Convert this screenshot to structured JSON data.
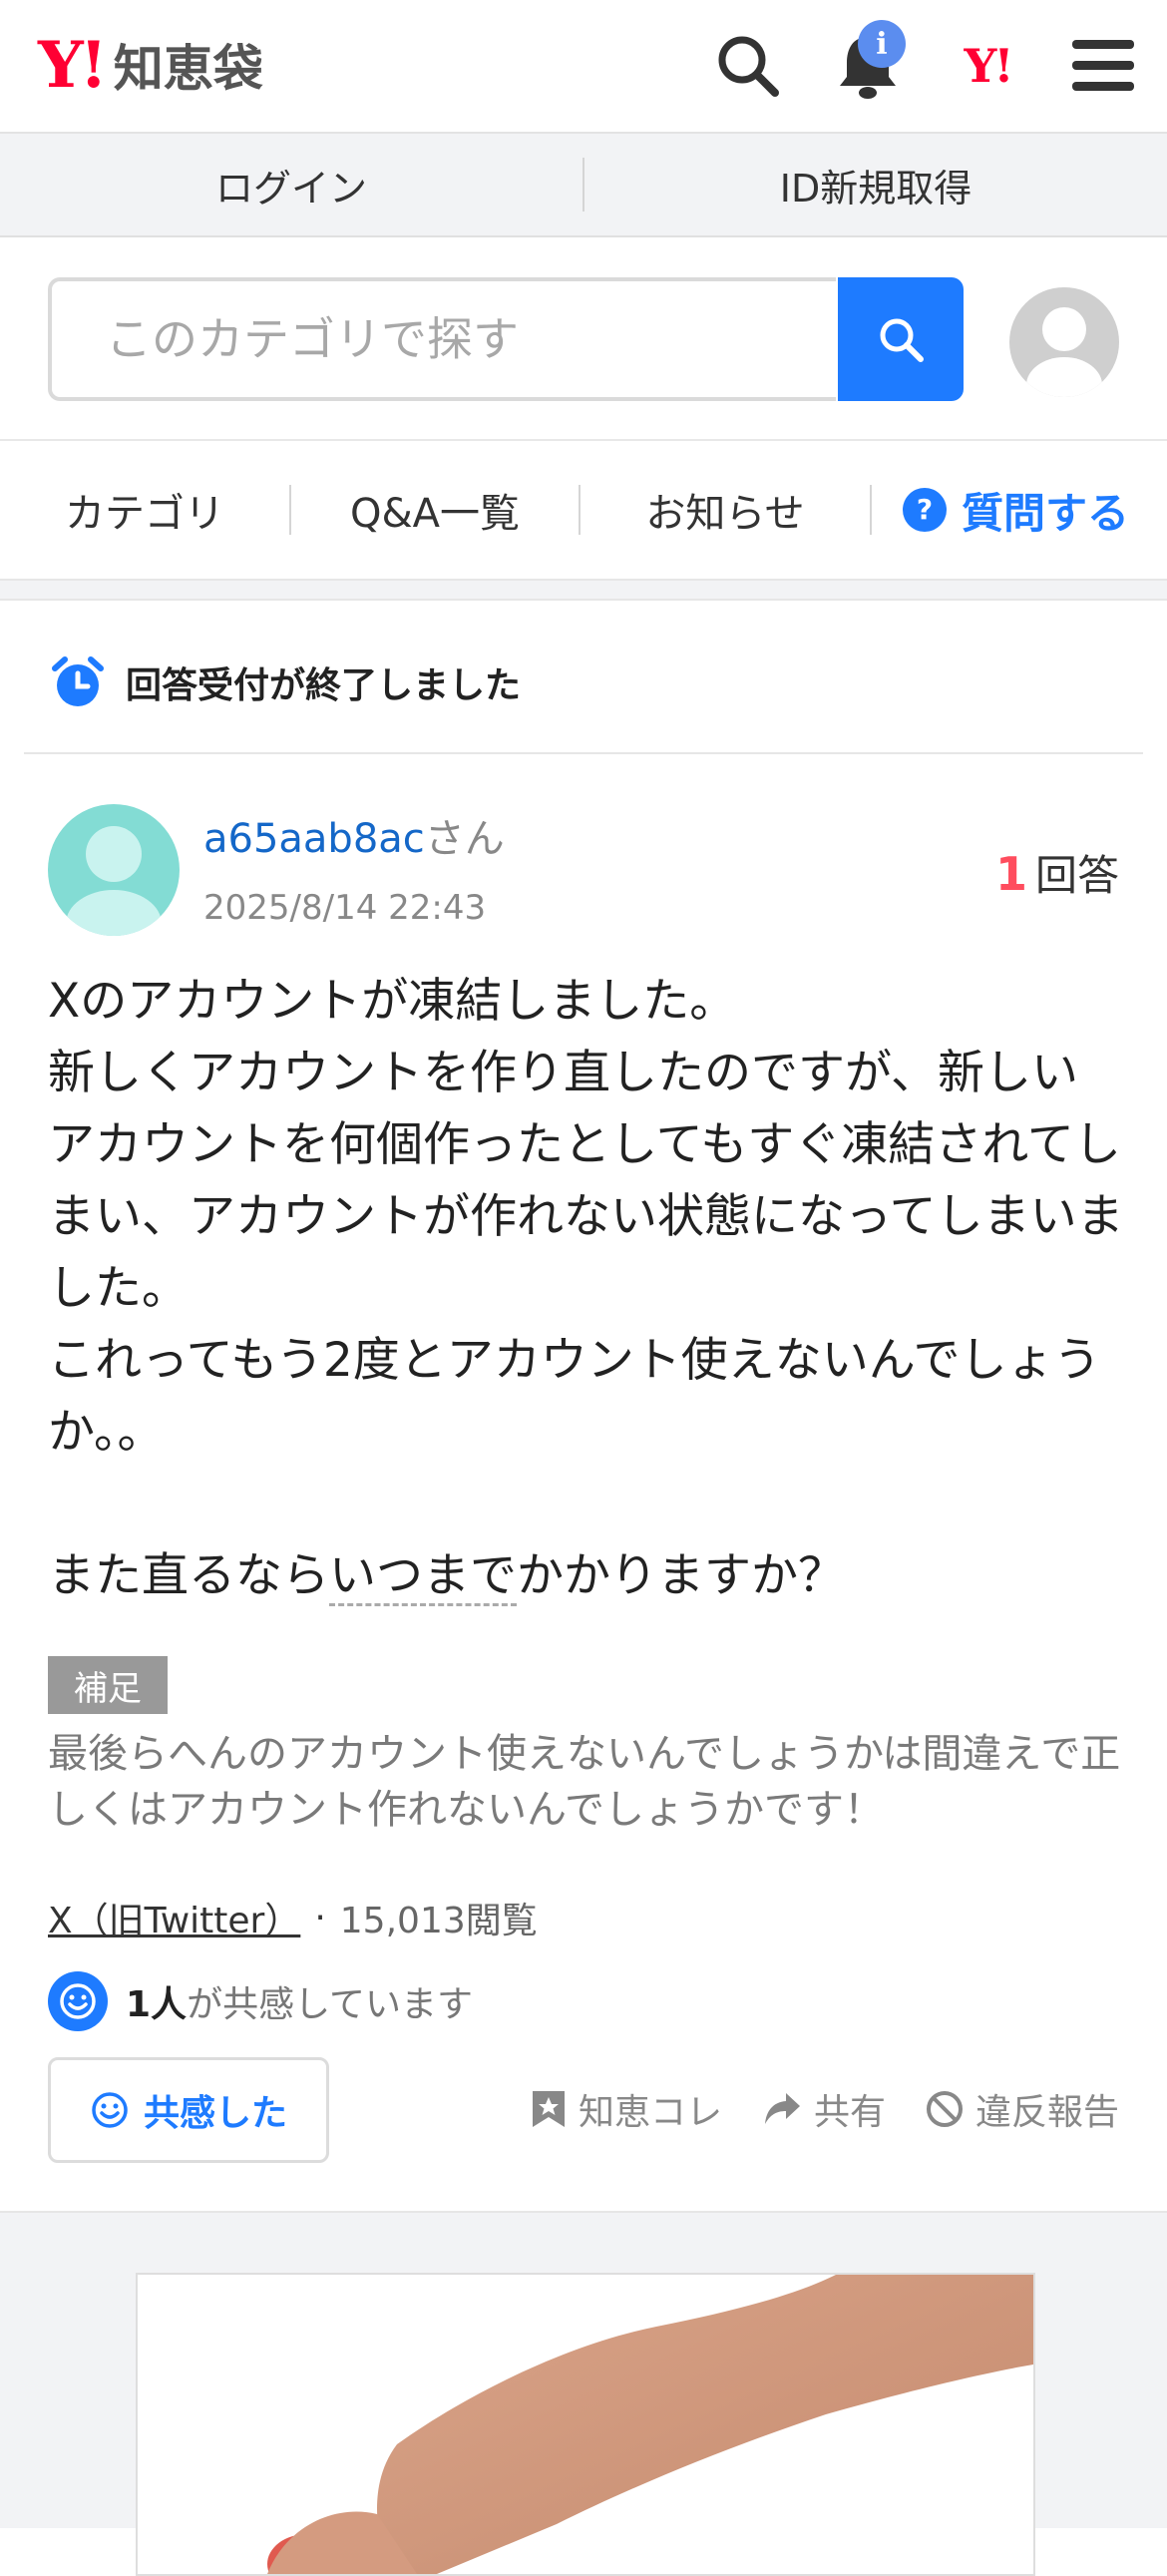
{
  "header": {
    "logo_y": "Y!",
    "logo_text": "知恵袋",
    "notification_badge": "i",
    "yahoo_icon": "Y!",
    "icons": [
      "search-icon",
      "bell-icon",
      "yahoo-icon",
      "menu-icon"
    ]
  },
  "auth": {
    "login": "ログイン",
    "register": "ID新規取得"
  },
  "search": {
    "placeholder": "このカテゴリで探す"
  },
  "nav": {
    "category": "カテゴリ",
    "qa_list": "Q&A一覧",
    "news": "お知らせ",
    "ask": "質問する"
  },
  "colors": {
    "accent": "#1e7bff",
    "brand": "#ff0033",
    "answer_count": "#ff4d5e"
  },
  "notice": {
    "closed": "回答受付が終了しました"
  },
  "question": {
    "user_name": "a65aab8ac",
    "user_suffix": "さん",
    "date": "2025/8/14 22:43",
    "answer_count": "1",
    "answer_label": "回答",
    "body_main": "Xのアカウントが凍結しました。\n新しくアカウントを作り直したのですが、新しいアカウントを何個作ったとしてもすぐ凍結されてしまい、アカウントが作れない状態になってしまいました。\nこれってもう2度とアカウント使えないんでしょうか。。\n\nまた直るなら",
    "body_link": "いつまで",
    "body_tail": "かかりますか？",
    "supplement_label": "補足",
    "supplement": "最後らへんのアカウント使えないんでしょうかは間違えで正しくはアカウント作れないんでしょうかです！",
    "category": "X（旧Twitter）",
    "views": "15,013閲覧",
    "empathy_count": "1人",
    "empathy_text": "が共感しています",
    "empathy_button": "共感した",
    "actions": {
      "collect": "知恵コレ",
      "share": "共有",
      "report": "違反報告"
    }
  }
}
